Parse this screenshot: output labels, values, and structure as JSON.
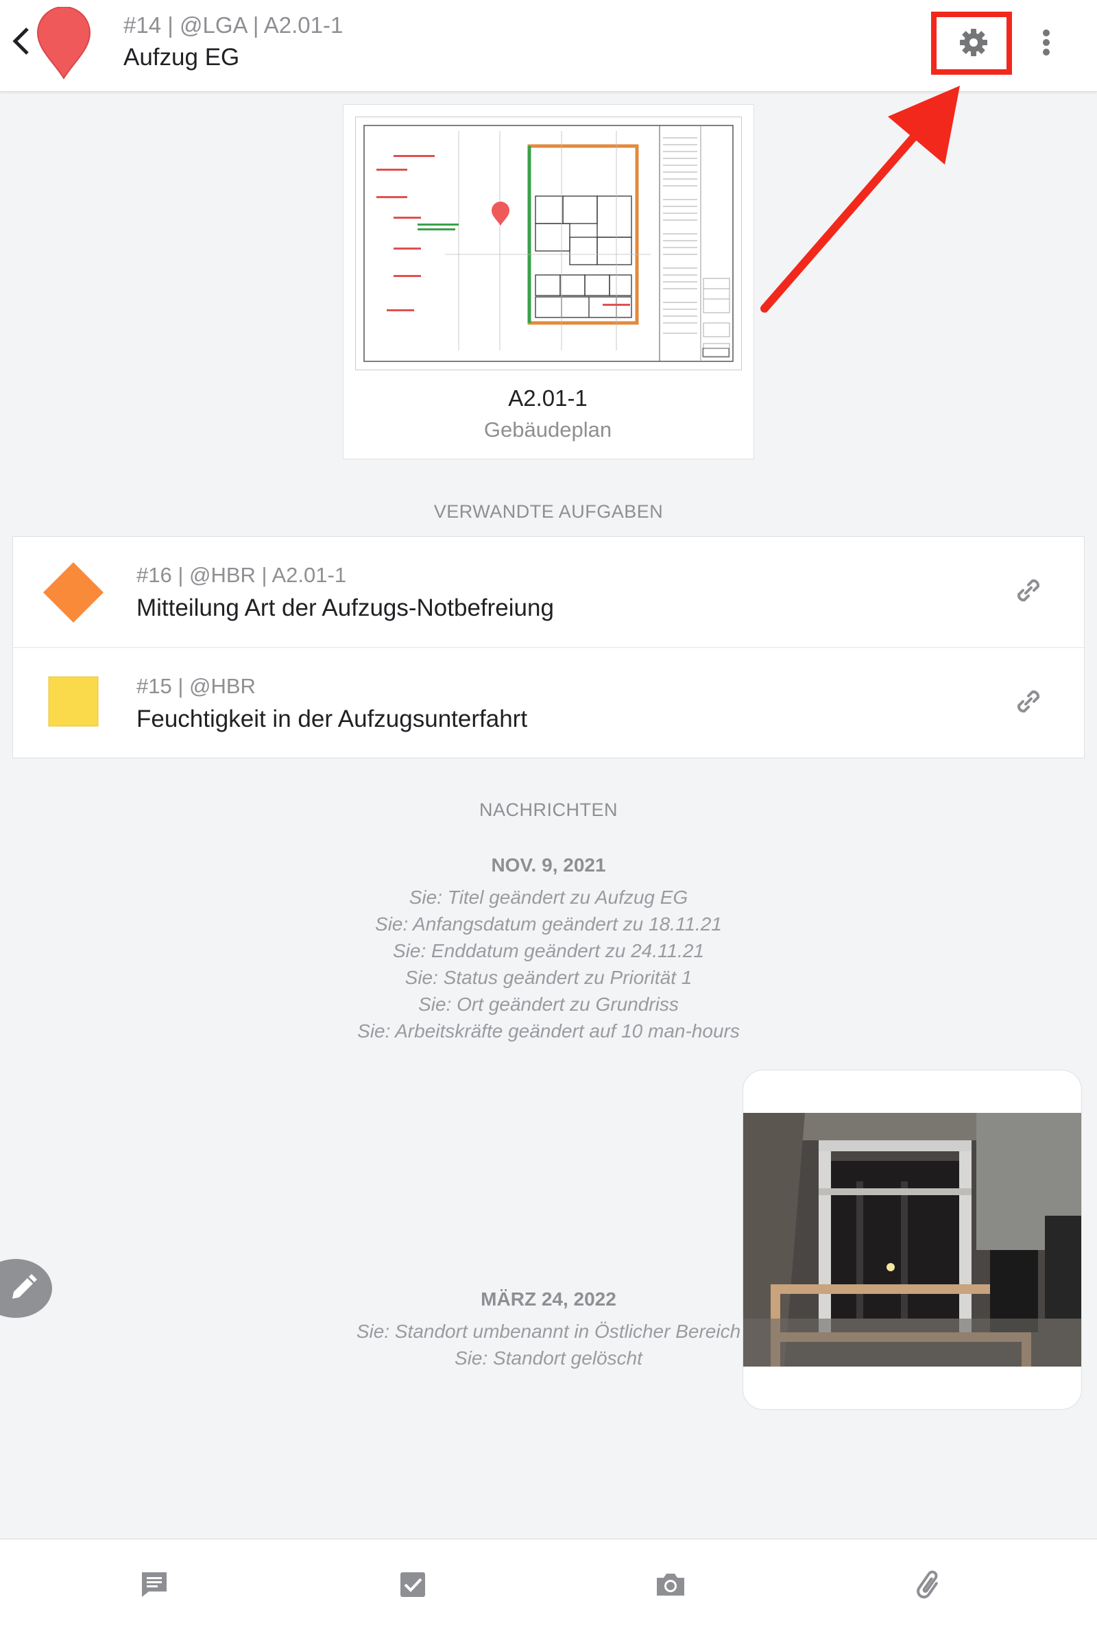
{
  "header": {
    "meta": "#14 | @LGA | A2.01-1",
    "title": "Aufzug EG",
    "pin_color": "#f0595a"
  },
  "plan": {
    "code": "A2.01-1",
    "type": "Gebäudeplan"
  },
  "related_tasks": {
    "section_title": "VERWANDTE AUFGABEN",
    "items": [
      {
        "meta": "#16 | @HBR | A2.01-1",
        "title": "Mitteilung Art der Aufzugs-Notbefreiung",
        "shape": "diamond",
        "color": "#f98a3a"
      },
      {
        "meta": "#15 | @HBR",
        "title": "Feuchtigkeit in der Aufzugsunterfahrt",
        "shape": "square",
        "color": "#fad94a"
      }
    ]
  },
  "messages": {
    "section_title": "NACHRICHTEN",
    "groups": [
      {
        "date": "NOV. 9, 2021",
        "lines": [
          "Sie: Titel geändert zu Aufzug EG",
          "Sie: Anfangsdatum geändert zu 18.11.21",
          "Sie: Enddatum geändert zu 24.11.21",
          "Sie: Status geändert zu Priorität 1",
          "Sie: Ort geändert zu Grundriss",
          "Sie: Arbeitskräfte geändert auf 10 man-hours"
        ]
      },
      {
        "date": "MÄRZ 24, 2022",
        "lines": [
          "Sie: Standort umbenannt in Östlicher Bereich",
          "Sie: Standort gelöscht"
        ]
      }
    ]
  },
  "toolbar": {
    "icons": [
      "comment-icon",
      "checkbox-icon",
      "camera-icon",
      "paperclip-icon"
    ]
  },
  "annotation": {
    "color": "#f2281c"
  }
}
